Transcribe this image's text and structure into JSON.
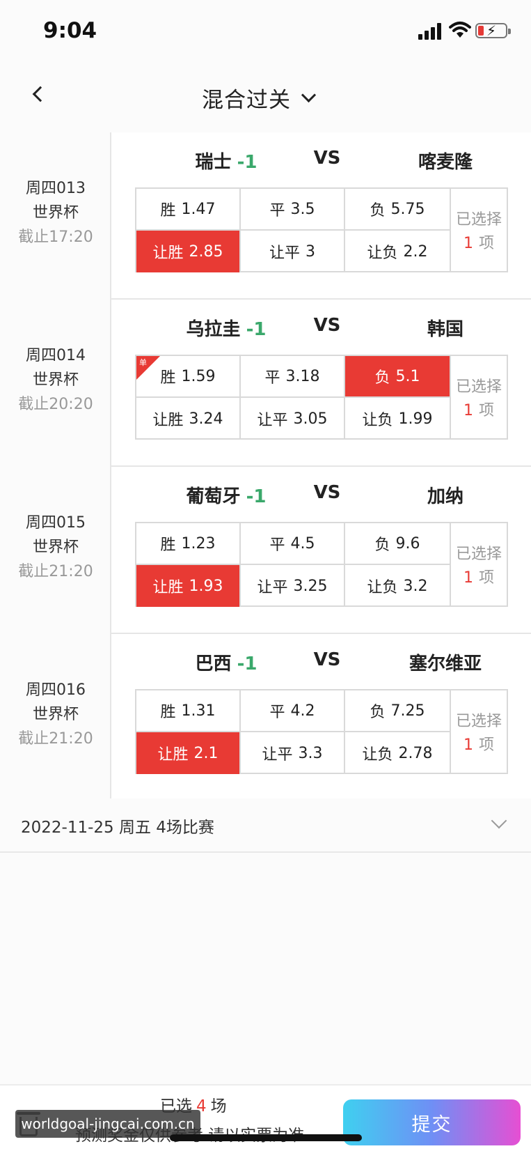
{
  "status_bar": {
    "time": "9:04"
  },
  "nav": {
    "title": "混合过关"
  },
  "matches": [
    {
      "code": "周四013",
      "league": "世界杯",
      "deadline": "截止17:20",
      "home": "瑞士",
      "handicap": "-1",
      "vs": "VS",
      "away": "喀麦隆",
      "odds": [
        {
          "label": "胜",
          "value": "1.47",
          "selected": false
        },
        {
          "label": "平",
          "value": "3.5",
          "selected": false
        },
        {
          "label": "负",
          "value": "5.75",
          "selected": false
        },
        {
          "label": "让胜",
          "value": "2.85",
          "selected": true
        },
        {
          "label": "让平",
          "value": "3",
          "selected": false
        },
        {
          "label": "让负",
          "value": "2.2",
          "selected": false
        }
      ],
      "picked_line1": "已选择",
      "picked_count": "1",
      "picked_unit": "项"
    },
    {
      "code": "周四014",
      "league": "世界杯",
      "deadline": "截止20:20",
      "home": "乌拉圭",
      "handicap": "-1",
      "vs": "VS",
      "away": "韩国",
      "single_tag": "单",
      "odds": [
        {
          "label": "胜",
          "value": "1.59",
          "selected": false
        },
        {
          "label": "平",
          "value": "3.18",
          "selected": false
        },
        {
          "label": "负",
          "value": "5.1",
          "selected": true
        },
        {
          "label": "让胜",
          "value": "3.24",
          "selected": false
        },
        {
          "label": "让平",
          "value": "3.05",
          "selected": false
        },
        {
          "label": "让负",
          "value": "1.99",
          "selected": false
        }
      ],
      "picked_line1": "已选择",
      "picked_count": "1",
      "picked_unit": "项"
    },
    {
      "code": "周四015",
      "league": "世界杯",
      "deadline": "截止21:20",
      "home": "葡萄牙",
      "handicap": "-1",
      "vs": "VS",
      "away": "加纳",
      "odds": [
        {
          "label": "胜",
          "value": "1.23",
          "selected": false
        },
        {
          "label": "平",
          "value": "4.5",
          "selected": false
        },
        {
          "label": "负",
          "value": "9.6",
          "selected": false
        },
        {
          "label": "让胜",
          "value": "1.93",
          "selected": true
        },
        {
          "label": "让平",
          "value": "3.25",
          "selected": false
        },
        {
          "label": "让负",
          "value": "3.2",
          "selected": false
        }
      ],
      "picked_line1": "已选择",
      "picked_count": "1",
      "picked_unit": "项"
    },
    {
      "code": "周四016",
      "league": "世界杯",
      "deadline": "截止21:20",
      "home": "巴西",
      "handicap": "-1",
      "vs": "VS",
      "away": "塞尔维亚",
      "odds": [
        {
          "label": "胜",
          "value": "1.31",
          "selected": false
        },
        {
          "label": "平",
          "value": "4.2",
          "selected": false
        },
        {
          "label": "负",
          "value": "7.25",
          "selected": false
        },
        {
          "label": "让胜",
          "value": "2.1",
          "selected": true
        },
        {
          "label": "让平",
          "value": "3.3",
          "selected": false
        },
        {
          "label": "让负",
          "value": "2.78",
          "selected": false
        }
      ],
      "picked_line1": "已选择",
      "picked_count": "1",
      "picked_unit": "项"
    }
  ],
  "day_row": {
    "text": "2022-11-25 周五 4场比赛"
  },
  "bottom_bar": {
    "selected_prefix": "已选",
    "selected_count": "4",
    "selected_suffix": "场",
    "disclaimer": "预测奖金仅供参考 请以实票为准",
    "submit_label": "提交",
    "watermark": "worldgoal-jingcai.com.cn"
  },
  "colors": {
    "selected_bg": "#e83a34",
    "handicap_green": "#3aa86b",
    "submit_gradient": [
      "#3fd0f0",
      "#6f8ff5",
      "#e64fd3"
    ]
  }
}
